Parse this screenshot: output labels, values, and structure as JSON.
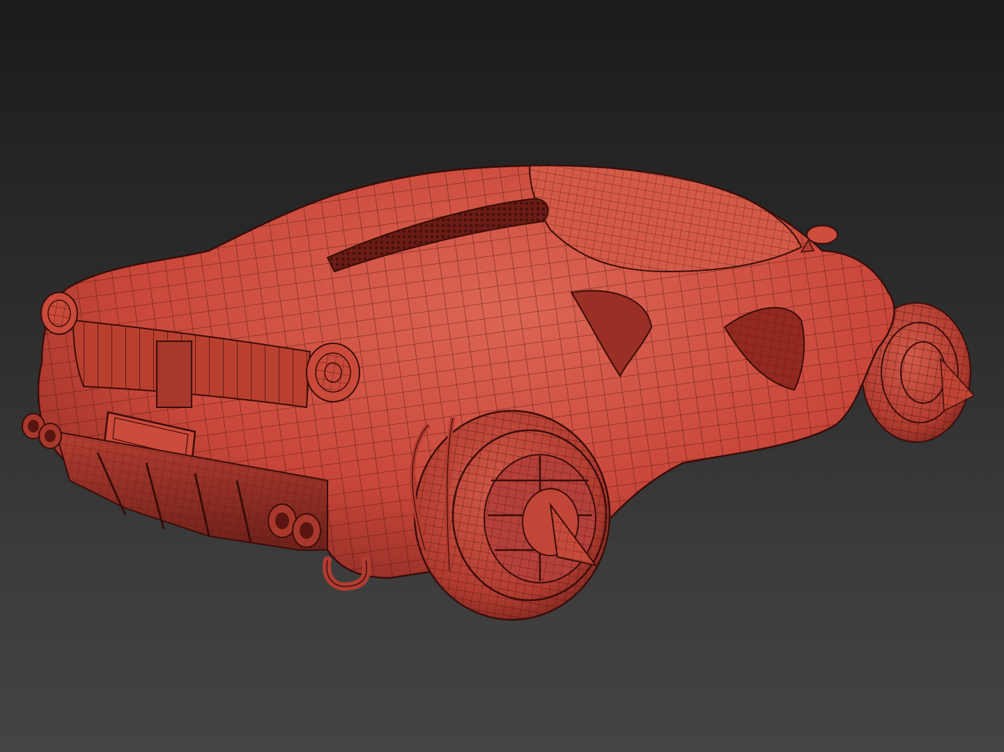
{
  "viewport": {
    "background_top": "#1b1b1b",
    "background_bottom": "#444444"
  },
  "model": {
    "body_color": "#c9473a",
    "body_shadow": "#8a2a22",
    "body_highlight": "#dc6654",
    "wire_color": "#3a0d0a"
  }
}
